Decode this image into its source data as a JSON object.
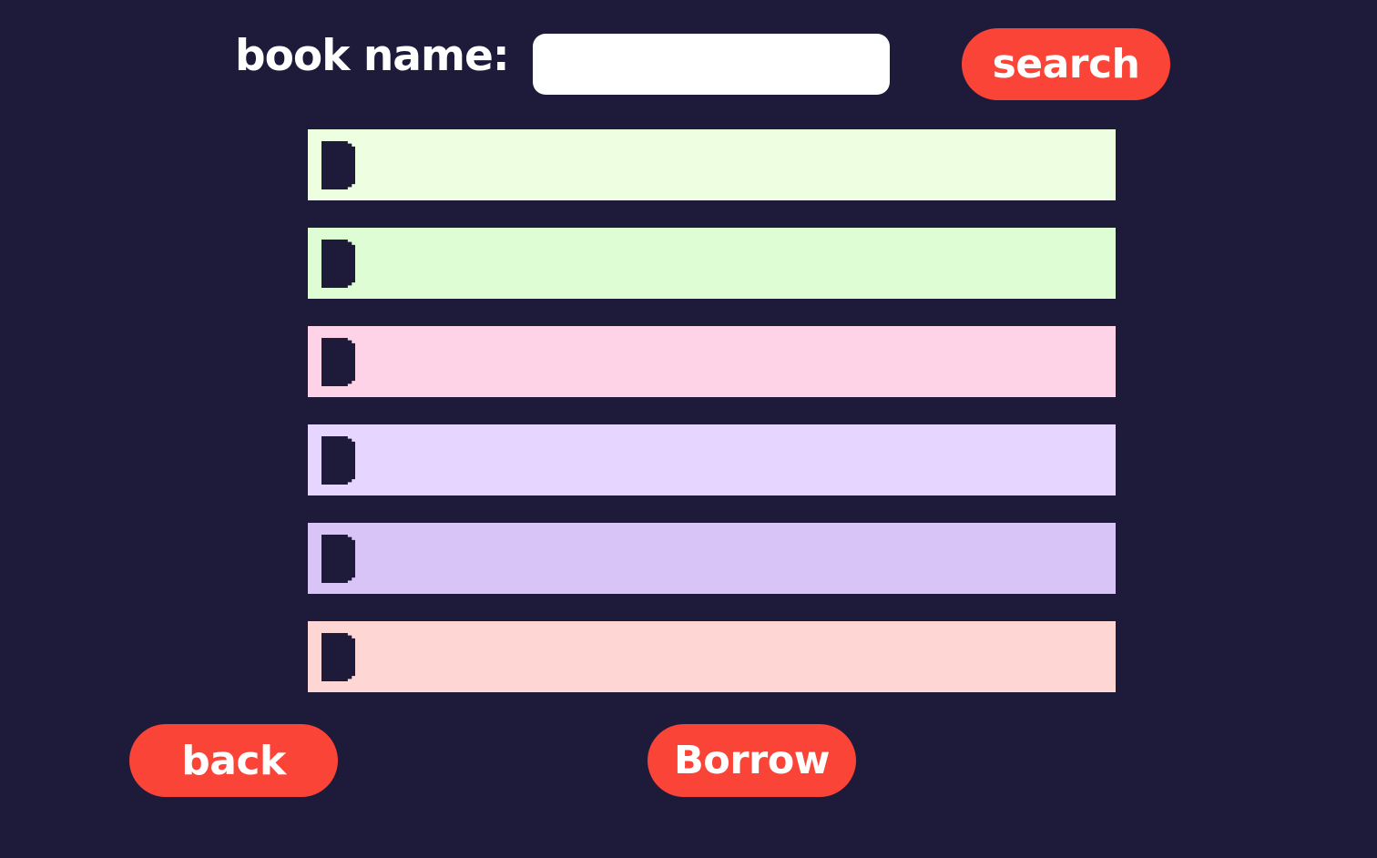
{
  "search": {
    "label": "book name:",
    "value": "",
    "placeholder": "",
    "button_label": "search"
  },
  "results": {
    "rows": [
      {
        "color": "#eefee1"
      },
      {
        "color": "#dffdd4"
      },
      {
        "color": "#fed3e7"
      },
      {
        "color": "#e6d5fe"
      },
      {
        "color": "#d8c4f6"
      },
      {
        "color": "#fed6d3"
      }
    ]
  },
  "actions": {
    "back_label": "back",
    "borrow_label": "Borrow"
  },
  "colors": {
    "background": "#1e1b3a",
    "accent": "#fb4438",
    "input_background": "#ffffff"
  },
  "icons": {
    "row_marker": "row-marker-icon"
  }
}
